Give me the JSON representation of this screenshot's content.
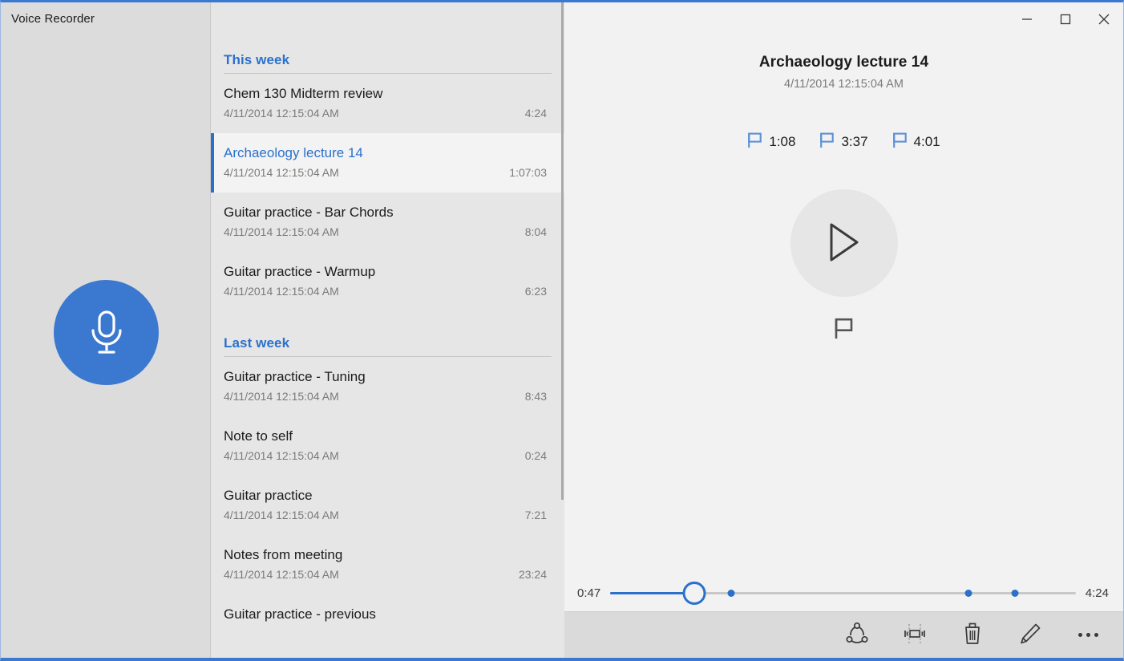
{
  "app": {
    "title": "Voice Recorder",
    "accent_color": "#2b71cc",
    "record_button_color": "#3b78cf"
  },
  "titlebar": {
    "minimize_label": "Minimize",
    "maximize_label": "Maximize",
    "close_label": "Close"
  },
  "left_panel": {
    "record_button_label": "Start recording",
    "record_icon": "microphone-icon"
  },
  "recordings_list": {
    "groups": [
      {
        "header": "This week",
        "items": [
          {
            "name": "Chem 130 Midterm review",
            "date": "4/11/2014 12:15:04 AM",
            "duration": "4:24",
            "selected": false
          },
          {
            "name": "Archaeology lecture 14",
            "date": "4/11/2014 12:15:04 AM",
            "duration": "1:07:03",
            "selected": true
          },
          {
            "name": "Guitar practice - Bar Chords",
            "date": "4/11/2014 12:15:04 AM",
            "duration": "8:04",
            "selected": false
          },
          {
            "name": "Guitar practice - Warmup",
            "date": "4/11/2014 12:15:04 AM",
            "duration": "6:23",
            "selected": false
          }
        ]
      },
      {
        "header": "Last week",
        "items": [
          {
            "name": "Guitar practice - Tuning",
            "date": "4/11/2014 12:15:04 AM",
            "duration": "8:43",
            "selected": false
          },
          {
            "name": "Note to self",
            "date": "4/11/2014 12:15:04 AM",
            "duration": "0:24",
            "selected": false
          },
          {
            "name": "Guitar practice",
            "date": "4/11/2014 12:15:04 AM",
            "duration": "7:21",
            "selected": false
          },
          {
            "name": "Notes from meeting",
            "date": "4/11/2014 12:15:04 AM",
            "duration": "23:24",
            "selected": false
          },
          {
            "name": "Guitar practice - previous",
            "date": "",
            "duration": "",
            "selected": false
          }
        ]
      }
    ]
  },
  "detail": {
    "title": "Archaeology lecture 14",
    "date": "4/11/2014 12:15:04 AM",
    "markers": [
      {
        "icon": "flag-icon",
        "time": "1:08"
      },
      {
        "icon": "flag-icon",
        "time": "3:37"
      },
      {
        "icon": "flag-icon",
        "time": "4:01"
      }
    ],
    "play_button_label": "Play",
    "add_marker_label": "Add marker",
    "seek": {
      "current_time": "0:47",
      "total_time": "4:24",
      "progress_percent": 18,
      "marker_positions_percent": [
        26,
        77,
        87
      ]
    }
  },
  "toolbar": {
    "buttons": [
      {
        "name": "share-button",
        "icon": "share-icon",
        "label": "Share"
      },
      {
        "name": "trim-button",
        "icon": "trim-icon",
        "label": "Trim"
      },
      {
        "name": "delete-button",
        "icon": "trash-icon",
        "label": "Delete"
      },
      {
        "name": "rename-button",
        "icon": "pencil-icon",
        "label": "Rename"
      },
      {
        "name": "more-button",
        "icon": "ellipsis-icon",
        "label": "See more"
      }
    ]
  }
}
